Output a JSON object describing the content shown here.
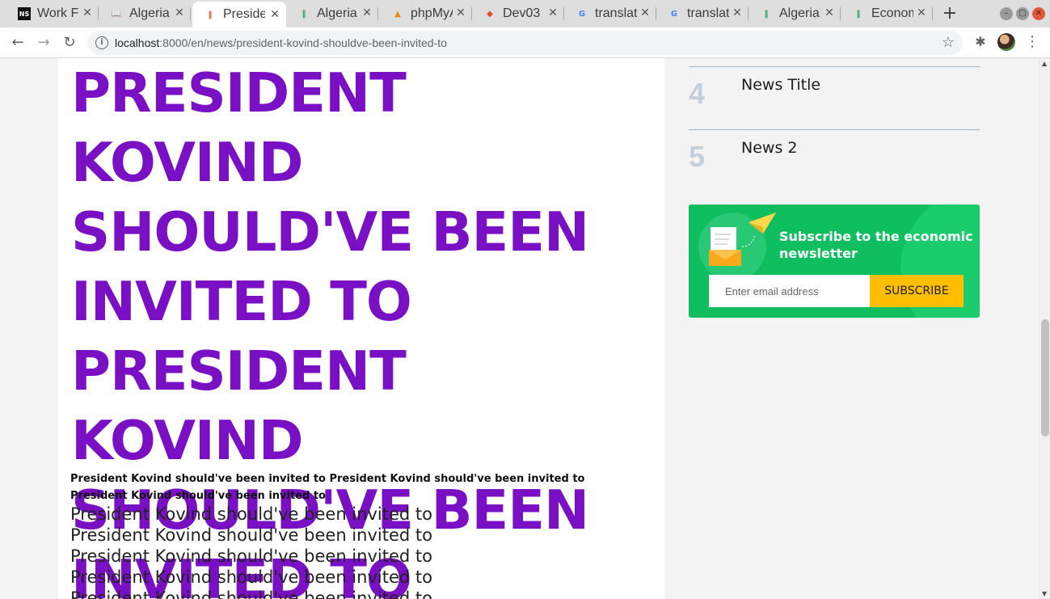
{
  "browser": {
    "tabs": [
      {
        "title": "Work From Home",
        "favicon": "ns-icon",
        "fav_text": "NS",
        "fav_color": "#d0021b"
      },
      {
        "title": "Algeria",
        "favicon": "book-icon",
        "fav_text": "📖",
        "fav_color": "#2a62a8"
      },
      {
        "title": "President",
        "favicon": "site-icon",
        "fav_text": "‖",
        "fav_color": "#e04a2b",
        "active": true
      },
      {
        "title": "Algeria",
        "favicon": "site-icon",
        "fav_text": "‖",
        "fav_color": "#2aa05a"
      },
      {
        "title": "phpMyAdmin",
        "favicon": "phpmyadmin-icon",
        "fav_text": "▲",
        "fav_color": "#e58a00"
      },
      {
        "title": "Dev03",
        "favicon": "gitlab-icon",
        "fav_text": "◆",
        "fav_color": "#e24329"
      },
      {
        "title": "translate",
        "favicon": "google-icon",
        "fav_text": "G",
        "fav_color": "#4285f4"
      },
      {
        "title": "translate",
        "favicon": "google-icon",
        "fav_text": "G",
        "fav_color": "#4285f4"
      },
      {
        "title": "Algeria",
        "favicon": "site-icon",
        "fav_text": "‖",
        "fav_color": "#2aa05a"
      },
      {
        "title": "Economy",
        "favicon": "site-icon",
        "fav_text": "‖",
        "fav_color": "#2aa05a"
      }
    ],
    "url_host": "localhost",
    "url_rest": ":8000/en/news/president-kovind-shouldve-been-invited-to"
  },
  "article": {
    "headline": " PRESIDENT KOVIND SHOULD'VE BEEN INVITED TO PRESIDENT KOVIND SHOULD'VE BEEN INVITED TO",
    "lead": " President Kovind should've been invited to President Kovind should've been invited to President Kovind should've been invited to",
    "body_lines": [
      "President Kovind should've been invited to",
      "President Kovind should've been invited to",
      "President Kovind should've been invited to",
      "President Kovind should've been invited to",
      "President Kovind should've been invited to"
    ]
  },
  "sidebar": {
    "ranked": [
      {
        "num": "4",
        "title": "News Title"
      },
      {
        "num": "5",
        "title": "News 2"
      }
    ],
    "newsletter": {
      "title": "Subscribe to the economic newsletter",
      "placeholder": "Enter email address",
      "button": "SUBSCRIBE",
      "color": "#0fbe5f",
      "button_color": "#ffbe00"
    }
  },
  "colors": {
    "headline": "#7a10c4"
  }
}
